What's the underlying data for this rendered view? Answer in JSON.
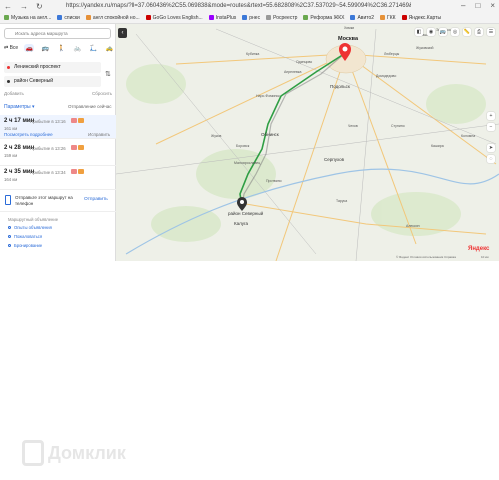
{
  "browser": {
    "url": "https://yandex.ru/maps/?ll=37.060436%2C55.069838&mode=routes&rtext=55.682808%2C37.537029~54.599094%2C36.271469&rtt=auto...",
    "bookmarks": [
      {
        "label": "Музыка на англ...",
        "color": "#6aa84f"
      },
      {
        "label": "списки",
        "color": "#3c78d8"
      },
      {
        "label": "англ спокойной но...",
        "color": "#e69138"
      },
      {
        "label": "GoGo Loves English...",
        "color": "#cc0000"
      },
      {
        "label": "InstaPlus",
        "color": "#9900ff"
      },
      {
        "label": "рнес",
        "color": "#3c78d8"
      },
      {
        "label": "Росреестр",
        "color": "#999999"
      },
      {
        "label": "Реформа ЖКХ",
        "color": "#6aa84f"
      },
      {
        "label": "Авито2",
        "color": "#3c78d8"
      },
      {
        "label": "ГКК",
        "color": "#e69138"
      },
      {
        "label": "Яндекс.Карты",
        "color": "#cc0000"
      }
    ]
  },
  "panel": {
    "search_placeholder": "Искать адреса маршрута",
    "mode_all": "Все",
    "from": "Ленинский проспект",
    "to": "район Северный",
    "add": "Добавить",
    "reset": "Сбросить",
    "params": "Параметры",
    "depart": "Отправление сейчас",
    "routes": [
      {
        "time": "2 ч 17 мин",
        "arrival": "Прибытие в 13:16",
        "distance": "161 км",
        "more": "Посмотреть подробнее",
        "fix": "Исправить"
      },
      {
        "time": "2 ч 28 мин",
        "arrival": "Прибытие в 13:26",
        "distance": "159 км",
        "more": "",
        "fix": ""
      },
      {
        "time": "2 ч 35 мин",
        "arrival": "Прибытие в 13:34",
        "distance": "164 км",
        "more": "",
        "fix": ""
      }
    ],
    "send_text": "Отправьте этот маршрут на телефон",
    "send_btn": "Отправить",
    "ann_title": "Маршрутный объявление",
    "ann_items": [
      "Опыты объявления",
      "Пожаловаться",
      "Бронирование"
    ]
  },
  "map": {
    "labels": [
      {
        "text": "Москва",
        "cls": "big"
      },
      {
        "text": "Химки",
        "cls": ""
      },
      {
        "text": "Балашиха",
        "cls": ""
      },
      {
        "text": "Люберцы",
        "cls": ""
      },
      {
        "text": "Подольск",
        "cls": "mid"
      },
      {
        "text": "Одинцово",
        "cls": ""
      },
      {
        "text": "Апрелевка",
        "cls": ""
      },
      {
        "text": "Наро-Фоминск",
        "cls": ""
      },
      {
        "text": "Обнинск",
        "cls": "mid"
      },
      {
        "text": "Малоярославец",
        "cls": ""
      },
      {
        "text": "Серпухов",
        "cls": "mid"
      },
      {
        "text": "Чехов",
        "cls": ""
      },
      {
        "text": "Домодедово",
        "cls": ""
      },
      {
        "text": "Таруса",
        "cls": ""
      },
      {
        "text": "Алексин",
        "cls": ""
      },
      {
        "text": "Калуга",
        "cls": "mid"
      },
      {
        "text": "район Северный",
        "cls": "mid"
      },
      {
        "text": "Кубинка",
        "cls": ""
      },
      {
        "text": "Жуковский",
        "cls": ""
      },
      {
        "text": "Ступино",
        "cls": ""
      },
      {
        "text": "Кашира",
        "cls": ""
      },
      {
        "text": "Коломна",
        "cls": ""
      },
      {
        "text": "Протвино",
        "cls": ""
      },
      {
        "text": "Жуков",
        "cls": ""
      },
      {
        "text": "Боровск",
        "cls": ""
      },
      {
        "text": "Электросталь",
        "cls": ""
      }
    ],
    "brand": "Яндекс",
    "footer": "© Яндекс  Условия использования  Справка",
    "scale": "10 км"
  },
  "watermark": "Домклик"
}
